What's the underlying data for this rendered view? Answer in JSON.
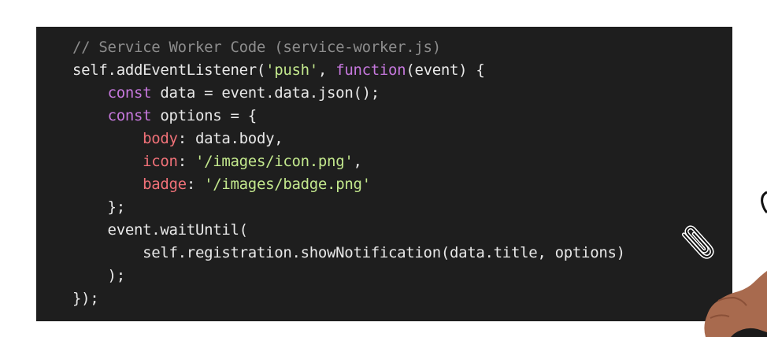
{
  "code": {
    "lines": [
      [
        {
          "t": "comment",
          "v": "// Service Worker Code (service-worker.js)"
        }
      ],
      [
        {
          "t": "plain",
          "v": "self.addEventListener("
        },
        {
          "t": "str",
          "v": "'push'"
        },
        {
          "t": "plain",
          "v": ", "
        },
        {
          "t": "kw",
          "v": "function"
        },
        {
          "t": "plain",
          "v": "(event) {"
        }
      ],
      [
        {
          "t": "plain",
          "v": "    "
        },
        {
          "t": "kw",
          "v": "const"
        },
        {
          "t": "plain",
          "v": " data = event.data.json();"
        }
      ],
      [
        {
          "t": "plain",
          "v": "    "
        },
        {
          "t": "kw",
          "v": "const"
        },
        {
          "t": "plain",
          "v": " options = {"
        }
      ],
      [
        {
          "t": "plain",
          "v": "        "
        },
        {
          "t": "prop",
          "v": "body"
        },
        {
          "t": "plain",
          "v": ": data.body,"
        }
      ],
      [
        {
          "t": "plain",
          "v": "        "
        },
        {
          "t": "prop",
          "v": "icon"
        },
        {
          "t": "plain",
          "v": ": "
        },
        {
          "t": "str",
          "v": "'/images/icon.png'"
        },
        {
          "t": "plain",
          "v": ","
        }
      ],
      [
        {
          "t": "plain",
          "v": "        "
        },
        {
          "t": "prop",
          "v": "badge"
        },
        {
          "t": "plain",
          "v": ": "
        },
        {
          "t": "str",
          "v": "'/images/badge.png'"
        }
      ],
      [
        {
          "t": "plain",
          "v": "    };"
        }
      ],
      [
        {
          "t": "plain",
          "v": "    event.waitUntil("
        }
      ],
      [
        {
          "t": "plain",
          "v": "        self.registration.showNotification(data.title, options)"
        }
      ],
      [
        {
          "t": "plain",
          "v": "    );"
        }
      ],
      [
        {
          "t": "plain",
          "v": "});"
        }
      ]
    ]
  },
  "colors": {
    "panel_background": "#1e1e1e",
    "comment": "#8c8c8c",
    "keyword": "#c678dd",
    "string": "#c3e88d",
    "property": "#f07178",
    "plain": "#e8e8e8"
  },
  "icons": {
    "cursor": "paperclip-icon"
  }
}
